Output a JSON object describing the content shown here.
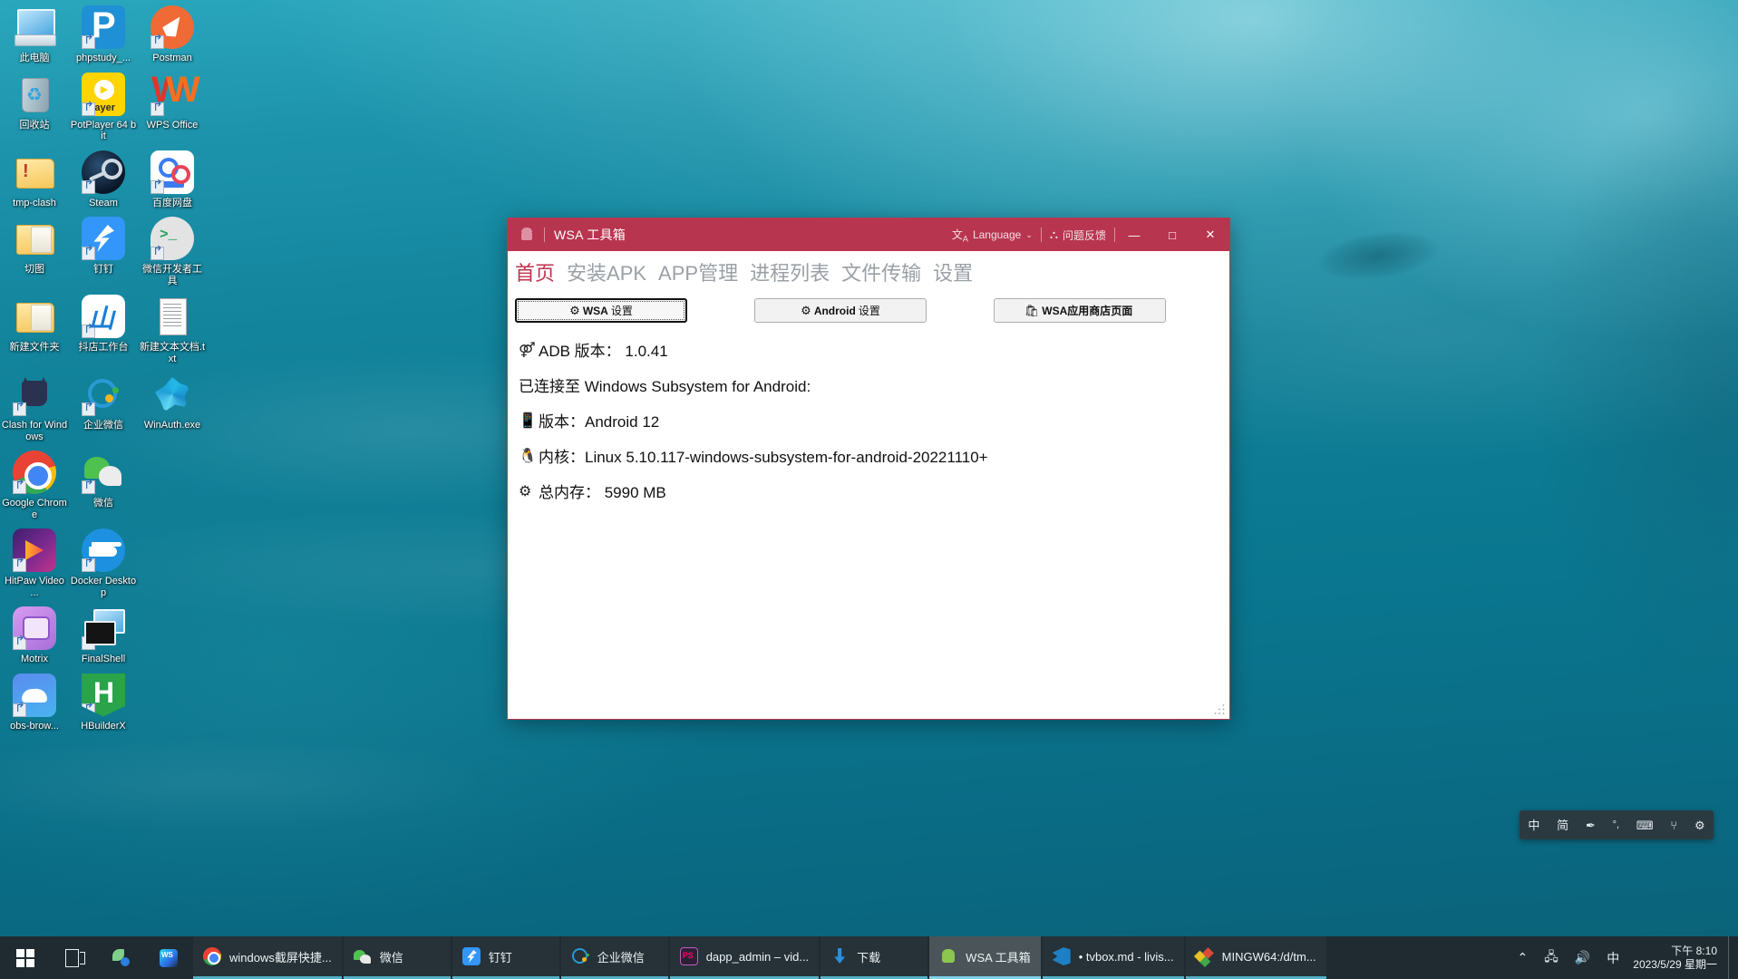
{
  "desktop": {
    "icons": [
      {
        "label": "此电脑",
        "art": "art-pc",
        "shortcut": false
      },
      {
        "label": "phpstudy_...",
        "art": "art-phpstudy",
        "shortcut": true
      },
      {
        "label": "Postman",
        "art": "art-postman",
        "shortcut": true
      },
      {
        "label": "回收站",
        "art": "art-recycle",
        "shortcut": false
      },
      {
        "label": "PotPlayer 64 bit",
        "art": "art-pot",
        "shortcut": true
      },
      {
        "label": "WPS Office",
        "art": "art-wps",
        "shortcut": true
      },
      {
        "label": "tmp-clash",
        "art": "art-folder warn",
        "shortcut": false
      },
      {
        "label": "Steam",
        "art": "art-steam",
        "shortcut": true
      },
      {
        "label": "百度网盘",
        "art": "art-baidu",
        "shortcut": true
      },
      {
        "label": "切图",
        "art": "art-folder",
        "shortcut": false
      },
      {
        "label": "钉钉",
        "art": "art-dingtalk",
        "shortcut": true
      },
      {
        "label": "微信开发者工具",
        "art": "art-wxdev",
        "shortcut": true
      },
      {
        "label": "新建文件夹",
        "art": "art-folder",
        "shortcut": false
      },
      {
        "label": "抖店工作台",
        "art": "art-douyin",
        "shortcut": true
      },
      {
        "label": "新建文本文档.txt",
        "art": "art-txt",
        "shortcut": false
      },
      {
        "label": "Clash for Windows",
        "art": "art-clash",
        "shortcut": true
      },
      {
        "label": "企业微信",
        "art": "art-qywx",
        "shortcut": true
      },
      {
        "label": "WinAuth.exe",
        "art": "art-winauth",
        "shortcut": false
      },
      {
        "label": "Google Chrome",
        "art": "art-chrome",
        "shortcut": true
      },
      {
        "label": "微信",
        "art": "art-wechat",
        "shortcut": true
      },
      {
        "label": "",
        "art": "",
        "shortcut": false
      },
      {
        "label": "HitPaw Video ...",
        "art": "art-hitpaw",
        "shortcut": true
      },
      {
        "label": "Docker Desktop",
        "art": "art-docker",
        "shortcut": true
      },
      {
        "label": "",
        "art": "",
        "shortcut": false
      },
      {
        "label": "Motrix",
        "art": "art-motrix",
        "shortcut": true
      },
      {
        "label": "FinalShell",
        "art": "art-finalshell",
        "shortcut": true
      },
      {
        "label": "",
        "art": "",
        "shortcut": false
      },
      {
        "label": "obs-brow...",
        "art": "art-obs",
        "shortcut": true
      },
      {
        "label": "HBuilderX",
        "art": "art-hbuilder",
        "shortcut": true
      },
      {
        "label": "",
        "art": "",
        "shortcut": false
      }
    ]
  },
  "window": {
    "title": "WSA 工具箱",
    "titlebar_color": "#b8354f",
    "language_label": "Language",
    "language_icon": "translate-icon",
    "feedback_label": "问题反馈",
    "feedback_icon": "github-icon",
    "minimize": "—",
    "maximize": "□",
    "close": "✕",
    "tabs": [
      {
        "label": "首页",
        "active": true
      },
      {
        "label": "安装APK",
        "active": false
      },
      {
        "label": "APP管理",
        "active": false
      },
      {
        "label": "进程列表",
        "active": false
      },
      {
        "label": "文件传输",
        "active": false
      },
      {
        "label": "设置",
        "active": false
      }
    ],
    "buttons": [
      {
        "id": "btn-wsa",
        "icon": "gear-icon",
        "glyph": "⚙",
        "bold_text": "WSA",
        "text": " 设置",
        "focused": true
      },
      {
        "id": "btn-android",
        "icon": "gear-icon",
        "glyph": "⚙",
        "bold_text": "Android",
        "text": " 设置",
        "focused": false
      },
      {
        "id": "btn-store",
        "icon": "store-icon",
        "glyph": "🛍",
        "bold_text": "WSA应用商店页面",
        "text": "",
        "focused": false
      }
    ],
    "info": {
      "adb_icon": "adb-icon",
      "adb_line": "ADB 版本： 1.0.41",
      "connected_line": "已连接至 Windows Subsystem for Android:",
      "version_icon": "android-icon",
      "version_line": "版本：Android  12",
      "kernel_icon": "penguin-icon",
      "kernel_line": "内核：Linux  5.10.117-windows-subsystem-for-android-20221110+",
      "memory_icon": "chip-icon",
      "memory_line": "总内存： 5990  MB"
    }
  },
  "ime_bar": {
    "items": [
      {
        "label": "中",
        "name": "ime-mode-chinese"
      },
      {
        "label": "简",
        "name": "ime-simplified"
      },
      {
        "label": "✒",
        "name": "ime-pen-icon"
      },
      {
        "label": "°,",
        "name": "ime-punctuation-icon"
      },
      {
        "label": "⌨",
        "name": "ime-keyboard-icon"
      },
      {
        "label": "⑂",
        "name": "ime-tray-icon"
      },
      {
        "label": "⚙",
        "name": "ime-settings-icon"
      }
    ]
  },
  "taskbar": {
    "start_icon": "windows-logo-icon",
    "pinned": [
      {
        "name": "task-view-icon",
        "art": "m-taskview"
      },
      {
        "name": "flower-app-icon",
        "art": "m-flower"
      },
      {
        "name": "webstorm-icon",
        "art": "m-ws"
      }
    ],
    "items": [
      {
        "label": "windows截屏快捷...",
        "art": "m-chrome",
        "name": "taskbar-item-chrome",
        "active": false
      },
      {
        "label": "微信",
        "art": "m-wechat",
        "name": "taskbar-item-wechat",
        "active": false
      },
      {
        "label": "钉钉",
        "art": "m-dingtalk",
        "name": "taskbar-item-dingtalk",
        "active": false
      },
      {
        "label": "企业微信",
        "art": "m-qywx",
        "name": "taskbar-item-wecom",
        "active": false
      },
      {
        "label": "dapp_admin – vid...",
        "art": "m-ps",
        "name": "taskbar-item-phpstorm",
        "active": false
      },
      {
        "label": "下载",
        "art": "m-dl",
        "name": "taskbar-item-downloads",
        "active": false
      },
      {
        "label": "WSA 工具箱",
        "art": "m-android",
        "name": "taskbar-item-wsa-toolbox",
        "active": true
      },
      {
        "label": "• tvbox.md - livis...",
        "art": "m-vscode",
        "name": "taskbar-item-vscode",
        "active": false
      },
      {
        "label": "MINGW64:/d/tm...",
        "art": "m-mingw",
        "name": "taskbar-item-mingw64",
        "active": false
      }
    ],
    "tray": [
      {
        "label": "⌃",
        "name": "show-hidden-icons-chevron"
      },
      {
        "label": "🖧",
        "name": "network-icon"
      },
      {
        "label": "🔊",
        "name": "volume-icon"
      },
      {
        "label": "中",
        "name": "ime-indicator"
      }
    ],
    "clock": {
      "time": "下午 8:10",
      "date": "2023/5/29 星期一"
    }
  }
}
